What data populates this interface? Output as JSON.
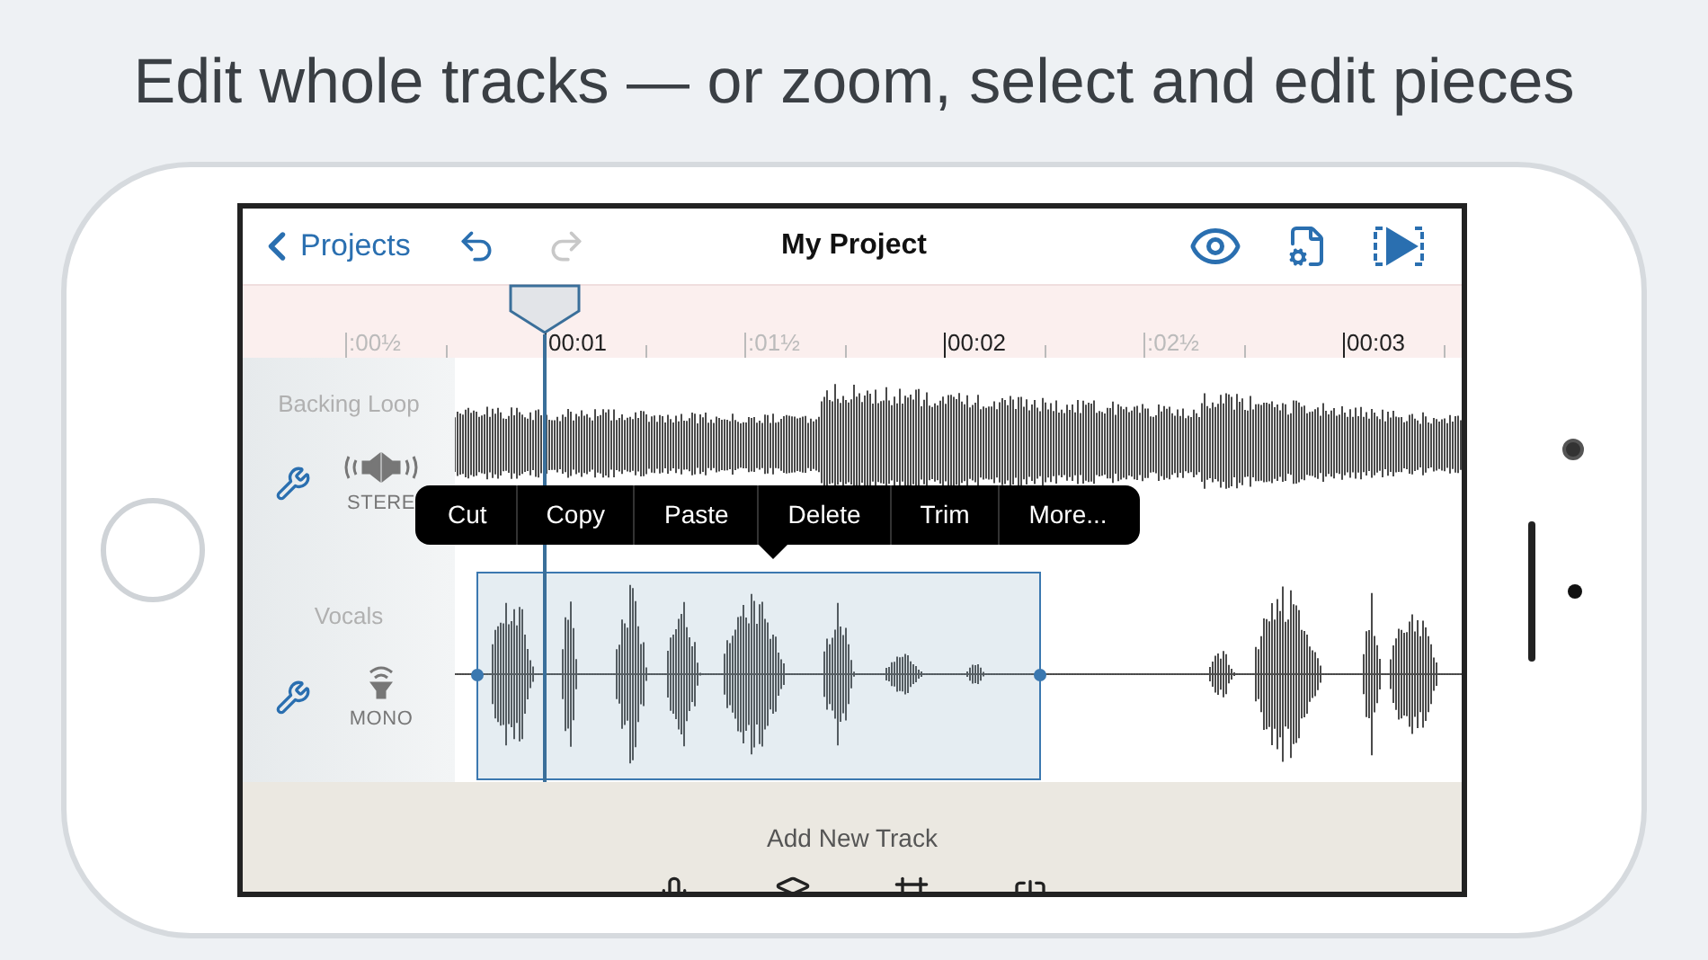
{
  "headline": "Edit whole tracks — or zoom, select and edit pieces",
  "nav": {
    "back": "Projects",
    "title": "My Project",
    "undo_enabled": true,
    "redo_enabled": false
  },
  "ruler": {
    "marks": [
      {
        "label": ":00½",
        "major": false
      },
      {
        "label": "00:01",
        "major": true
      },
      {
        "label": ":01½",
        "major": false
      },
      {
        "label": "00:02",
        "major": true
      },
      {
        "label": ":02½",
        "major": false
      },
      {
        "label": "00:03",
        "major": true
      }
    ]
  },
  "tracks": [
    {
      "name": "Backing Loop",
      "kind": "stereo",
      "mode": "STERE",
      "selection": false
    },
    {
      "name": "Vocals",
      "kind": "mono",
      "mode": "MONO",
      "selection": true
    }
  ],
  "edit_menu": [
    "Cut",
    "Copy",
    "Paste",
    "Delete",
    "Trim",
    "More..."
  ],
  "add_track": {
    "label": "Add New Track"
  }
}
